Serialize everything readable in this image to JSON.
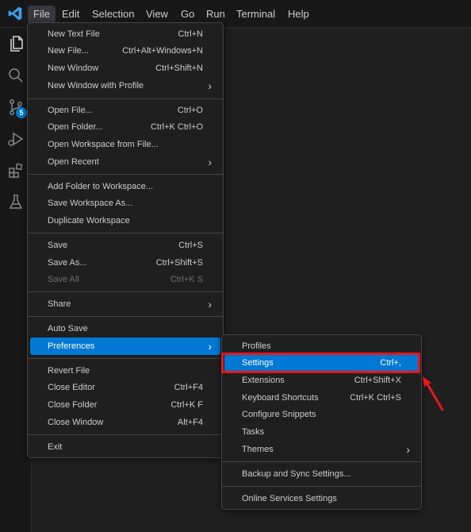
{
  "menubar": {
    "logo_icon": "vscode-logo-icon",
    "items": [
      "File",
      "Edit",
      "Selection",
      "View",
      "Go",
      "Run",
      "Terminal",
      "Help"
    ]
  },
  "activitybar": {
    "icons": [
      "files-icon",
      "search-icon",
      "source-control-icon",
      "run-debug-icon",
      "extensions-icon",
      "testing-icon"
    ],
    "source_control_badge": "5"
  },
  "file_menu": {
    "new_text_file": {
      "label": "New Text File",
      "shortcut": "Ctrl+N"
    },
    "new_file": {
      "label": "New File...",
      "shortcut": "Ctrl+Alt+Windows+N"
    },
    "new_window": {
      "label": "New Window",
      "shortcut": "Ctrl+Shift+N"
    },
    "new_window_profile": {
      "label": "New Window with Profile"
    },
    "open_file": {
      "label": "Open File...",
      "shortcut": "Ctrl+O"
    },
    "open_folder": {
      "label": "Open Folder...",
      "shortcut": "Ctrl+K Ctrl+O"
    },
    "open_workspace": {
      "label": "Open Workspace from File..."
    },
    "open_recent": {
      "label": "Open Recent"
    },
    "add_folder": {
      "label": "Add Folder to Workspace..."
    },
    "save_workspace_as": {
      "label": "Save Workspace As..."
    },
    "duplicate_workspace": {
      "label": "Duplicate Workspace"
    },
    "save": {
      "label": "Save",
      "shortcut": "Ctrl+S"
    },
    "save_as": {
      "label": "Save As...",
      "shortcut": "Ctrl+Shift+S"
    },
    "save_all": {
      "label": "Save All",
      "shortcut": "Ctrl+K S"
    },
    "share": {
      "label": "Share"
    },
    "auto_save": {
      "label": "Auto Save"
    },
    "preferences": {
      "label": "Preferences"
    },
    "revert_file": {
      "label": "Revert File"
    },
    "close_editor": {
      "label": "Close Editor",
      "shortcut": "Ctrl+F4"
    },
    "close_folder": {
      "label": "Close Folder",
      "shortcut": "Ctrl+K F"
    },
    "close_window": {
      "label": "Close Window",
      "shortcut": "Alt+F4"
    },
    "exit": {
      "label": "Exit"
    }
  },
  "preferences_menu": {
    "profiles": {
      "label": "Profiles"
    },
    "settings": {
      "label": "Settings",
      "shortcut": "Ctrl+,"
    },
    "extensions": {
      "label": "Extensions",
      "shortcut": "Ctrl+Shift+X"
    },
    "keyboard_shortcuts": {
      "label": "Keyboard Shortcuts",
      "shortcut": "Ctrl+K Ctrl+S"
    },
    "configure_snippets": {
      "label": "Configure Snippets"
    },
    "tasks": {
      "label": "Tasks"
    },
    "themes": {
      "label": "Themes"
    },
    "backup_sync": {
      "label": "Backup and Sync Settings..."
    },
    "online_services": {
      "label": "Online Services Settings"
    }
  },
  "colors": {
    "accent": "#0078d4",
    "annotation": "#e8161d",
    "menu_background": "#1f1f1f",
    "background": "#181818"
  }
}
